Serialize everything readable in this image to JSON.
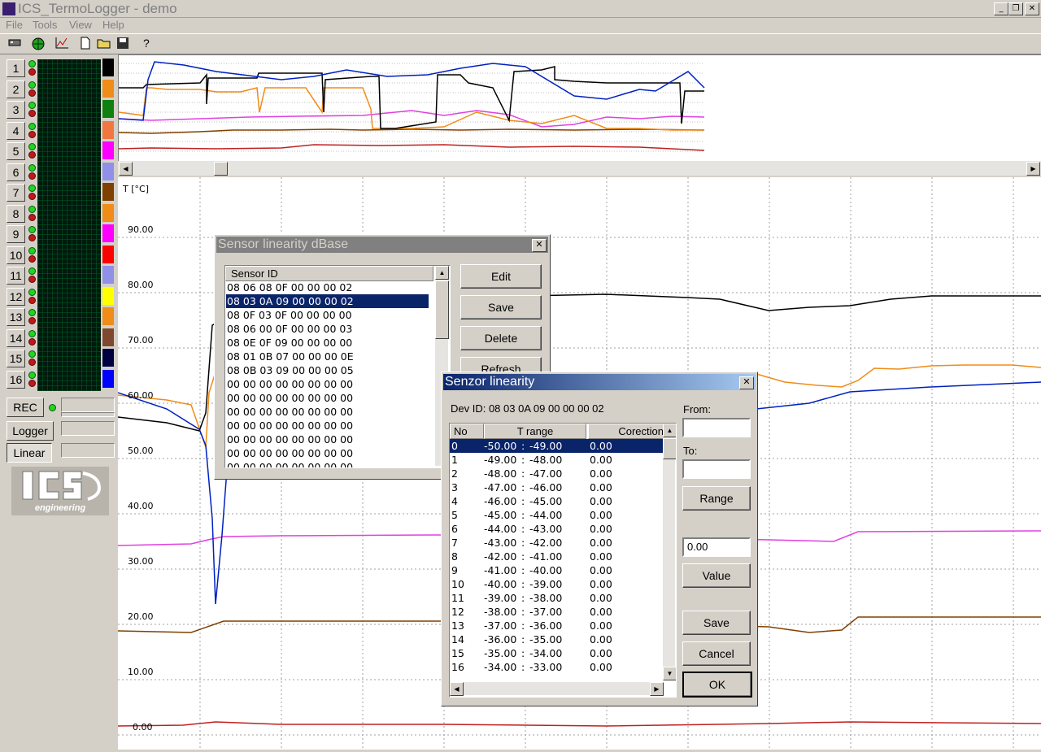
{
  "window": {
    "title": "ICS_TermoLogger - demo"
  },
  "menu": [
    "File",
    "Tools",
    "View",
    "Help"
  ],
  "toolbar": {
    "icons": [
      "device-icon",
      "globe-icon",
      "chart-icon",
      "new-file-icon",
      "open-folder-icon",
      "save-disk-icon",
      "help-icon"
    ]
  },
  "channels": {
    "numbers": [
      "1",
      "2",
      "3",
      "4",
      "5",
      "6",
      "7",
      "8",
      "9",
      "10",
      "11",
      "12",
      "13",
      "14",
      "15",
      "16"
    ],
    "colors": [
      "#000000",
      "#f08c18",
      "#108010",
      "#f07840",
      "#ff00ff",
      "#9090e8",
      "#804000",
      "#f08c18",
      "#ff00ff",
      "#ff0000",
      "#9090e8",
      "#ffff00",
      "#f08c18",
      "#804830",
      "#000040",
      "#0000ff"
    ]
  },
  "side_buttons": {
    "rec": "REC",
    "logger": "Logger",
    "linear": "Linear"
  },
  "logo": {
    "name": "ICS logo",
    "text": "engineering"
  },
  "main_chart": {
    "y_label": "T [°C]",
    "y_ticks": [
      "90.00",
      "80.00",
      "70.00",
      "60.00",
      "50.00",
      "40.00",
      "30.00",
      "20.00",
      "10.00",
      "0.00"
    ]
  },
  "sensor_db": {
    "title": "Sensor linearity dBase",
    "column": "Sensor ID",
    "rows": [
      "08 06 08 0F 00 00 00 02",
      "08 03 0A 09 00 00 00 02",
      "08 0F 03 0F 00 00 00 00",
      "08 06 00 0F 00 00 00 03",
      "08 0E 0F 09 00 00 00 00",
      "08 01 0B 07 00 00 00 0E",
      "08 0B 03 09 00 00 00 05",
      "00 00 00 00 00 00 00 00",
      "00 00 00 00 00 00 00 00",
      "00 00 00 00 00 00 00 00",
      "00 00 00 00 00 00 00 00",
      "00 00 00 00 00 00 00 00",
      "00 00 00 00 00 00 00 00",
      "00 00 00 00 00 00 00 00"
    ],
    "selected_index": 1,
    "buttons": {
      "edit": "Edit",
      "save": "Save",
      "delete": "Delete",
      "refresh": "Refresh"
    }
  },
  "senzor": {
    "title": "Senzor linearity",
    "dev_id": "Dev ID:  08 03 0A 09 00 00 00 02",
    "columns": {
      "no": "No",
      "range": "T range",
      "corr": "Corection"
    },
    "rows": [
      {
        "no": "0",
        "from": "-50.00",
        "to": "-49.00",
        "corr": "0.00"
      },
      {
        "no": "1",
        "from": "-49.00",
        "to": "-48.00",
        "corr": "0.00"
      },
      {
        "no": "2",
        "from": "-48.00",
        "to": "-47.00",
        "corr": "0.00"
      },
      {
        "no": "3",
        "from": "-47.00",
        "to": "-46.00",
        "corr": "0.00"
      },
      {
        "no": "4",
        "from": "-46.00",
        "to": "-45.00",
        "corr": "0.00"
      },
      {
        "no": "5",
        "from": "-45.00",
        "to": "-44.00",
        "corr": "0.00"
      },
      {
        "no": "6",
        "from": "-44.00",
        "to": "-43.00",
        "corr": "0.00"
      },
      {
        "no": "7",
        "from": "-43.00",
        "to": "-42.00",
        "corr": "0.00"
      },
      {
        "no": "8",
        "from": "-42.00",
        "to": "-41.00",
        "corr": "0.00"
      },
      {
        "no": "9",
        "from": "-41.00",
        "to": "-40.00",
        "corr": "0.00"
      },
      {
        "no": "10",
        "from": "-40.00",
        "to": "-39.00",
        "corr": "0.00"
      },
      {
        "no": "11",
        "from": "-39.00",
        "to": "-38.00",
        "corr": "0.00"
      },
      {
        "no": "12",
        "from": "-38.00",
        "to": "-37.00",
        "corr": "0.00"
      },
      {
        "no": "13",
        "from": "-37.00",
        "to": "-36.00",
        "corr": "0.00"
      },
      {
        "no": "14",
        "from": "-36.00",
        "to": "-35.00",
        "corr": "0.00"
      },
      {
        "no": "15",
        "from": "-35.00",
        "to": "-34.00",
        "corr": "0.00"
      },
      {
        "no": "16",
        "from": "-34.00",
        "to": "-33.00",
        "corr": "0.00"
      }
    ],
    "selected_index": 0,
    "separator": ":",
    "from_label": "From:",
    "from_value": "",
    "to_label": "To:",
    "to_value": "",
    "range_button": "Range",
    "value_field": "0.00",
    "value_button": "Value",
    "save_button": "Save",
    "cancel_button": "Cancel",
    "ok_button": "OK"
  }
}
